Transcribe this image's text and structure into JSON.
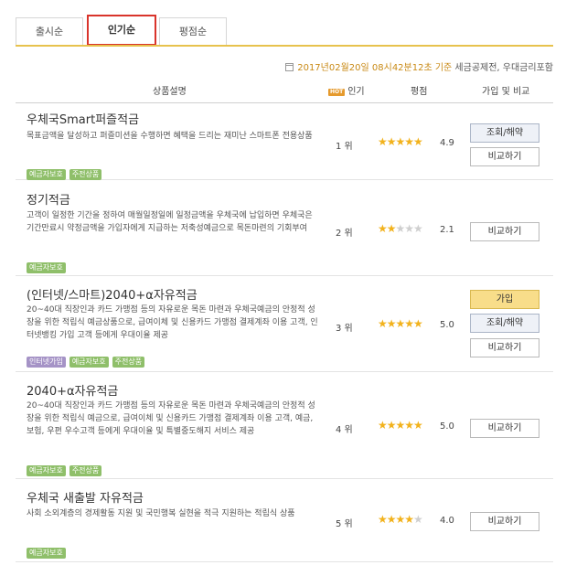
{
  "tabs": [
    {
      "label": "출시순"
    },
    {
      "label": "인기순"
    },
    {
      "label": "평점순"
    }
  ],
  "info": {
    "date": "2017년02월20일 08시42분12초 기준",
    "note": " 세금공제전, 우대금리포함"
  },
  "table": {
    "headers": {
      "desc": "상품설명",
      "hot_badge": "HOT",
      "popularity": "인기",
      "rating": "평점",
      "join_compare": "가입 및 비교"
    }
  },
  "products": [
    {
      "name": "우체국Smart퍼즐적금",
      "desc": "목표금액을 달성하고 퍼즐미션을 수행하면 혜택을 드리는 재미난 스마트폰 전용상품",
      "badges": [
        "예금자보호",
        "주전상품"
      ],
      "rank": "1 위",
      "stars": "★★★★★",
      "stars_empty": "",
      "score": "4.9",
      "buttons": {
        "view": "조회/해약",
        "compare": "비교하기"
      }
    },
    {
      "name": "정기적금",
      "desc": "고객이 일정한 기간을 정하여 매월일정일에 일정금액을 우체국에 납입하면 우체국은 기간만료시 약정금액을 가입자에게 지급하는 저축성예금으로 목돈마련의 기회부여",
      "badges": [
        "예금자보호"
      ],
      "rank": "2 위",
      "stars": "★★",
      "stars_empty": "★★★",
      "score": "2.1",
      "buttons": {
        "compare": "비교하기"
      }
    },
    {
      "name": "(인터넷/스마트)2040+α자유적금",
      "desc": "20~40대 직장인과 카드 가맹점 등의 자유로운 목돈 마련과 우체국예금의 안정적 성장을 위한 적립식 예금상품으로, 급여이체 및 신용카드 가맹점 결제계좌 이용 고객, 인터넷뱅킹 가입 고객 등에게 우대이율 제공",
      "badges": [
        "인터넷가입",
        "예금자보호",
        "주전상품"
      ],
      "rank": "3 위",
      "stars": "★★★★★",
      "stars_empty": "",
      "score": "5.0",
      "buttons": {
        "join": "가입",
        "view": "조회/해약",
        "compare": "비교하기"
      }
    },
    {
      "name": "2040+α자유적금",
      "desc": "20~40대 직장인과 카드 가맹점 등의 자유로운 목돈 마련과 우체국예금의 안정적 성장을 위한 적립식 예금으로, 급여이체 및 신용카드 가맹점 결제계좌 이용 고객, 예금, 보험, 우편 우수고객 등에게 우대이율 및 특별중도해지 서비스 제공",
      "badges": [
        "예금자보호",
        "주전상품"
      ],
      "rank": "4 위",
      "stars": "★★★★★",
      "stars_empty": "",
      "score": "5.0",
      "buttons": {
        "compare": "비교하기"
      }
    },
    {
      "name": "우체국 새출발 자유적금",
      "desc": "사회 소외계층의 경제활동 지원 및 국민행복 실현을 적극 지원하는 적립식 상품",
      "badges": [
        "예금자보호"
      ],
      "rank": "5 위",
      "stars": "★★★★",
      "stars_empty": "★",
      "score": "4.0",
      "buttons": {
        "compare": "비교하기"
      }
    }
  ]
}
